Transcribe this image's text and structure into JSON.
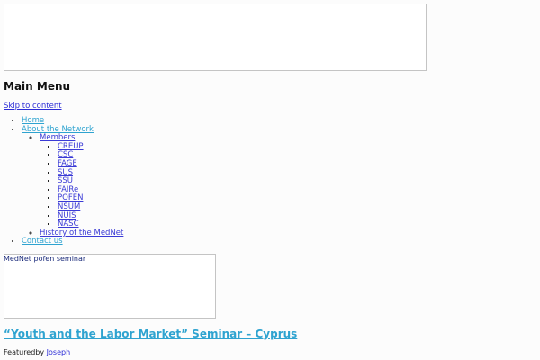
{
  "main_menu": "Main Menu",
  "skip_link": "Skip to content",
  "nav": {
    "home": "Home",
    "about": "About the Network",
    "members": "Members",
    "member_items": [
      "CREUP",
      "CSC",
      "FAGE",
      "SUS",
      "SSU",
      "FAIRe",
      "POFEN",
      "NSUM",
      "NUIS",
      "NASC"
    ],
    "history": "History of the MedNet",
    "contact": "Contact us"
  },
  "card": {
    "caption": "MedNet pofen seminar"
  },
  "post": {
    "title": "“Youth and the Labor Market” Seminar – Cyprus",
    "featured_prefix": "Featuredby",
    "author": "Joseph"
  }
}
